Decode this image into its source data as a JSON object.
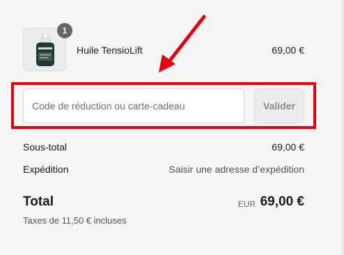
{
  "cart": {
    "item": {
      "name": "Huile TensioLift",
      "price": "69,00 €",
      "quantity": "1",
      "image_icon": "serum-bottle-icon"
    }
  },
  "discount": {
    "placeholder": "Code de réduction ou carte-cadeau",
    "value": "",
    "apply_label": "Valider"
  },
  "summary": {
    "subtotal_label": "Sous-total",
    "subtotal_value": "69,00 €",
    "shipping_label": "Expédition",
    "shipping_value": "Saisir une adresse d’expédition",
    "total_label": "Total",
    "currency": "EUR",
    "total_value": "69,00 €",
    "taxes_note": "Taxes de 11,50 € incluses"
  },
  "annotation": {
    "highlight_color": "#e8000e",
    "arrow_color": "#e8000e"
  }
}
